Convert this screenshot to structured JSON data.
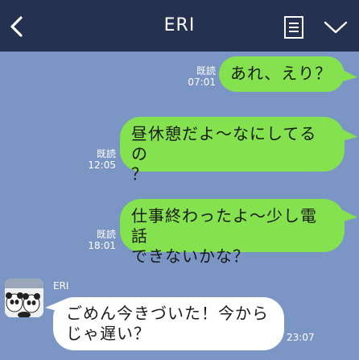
{
  "header": {
    "title": "ERI",
    "back_icon": "chevron-left-icon",
    "notes_icon": "notes-icon",
    "menu_icon": "chevron-down-icon",
    "background_color": "#243150"
  },
  "chat": {
    "background_color": "#7b96c4",
    "sent_bubble_color": "#84e24e",
    "received_bubble_color": "#ffffff",
    "messages": [
      {
        "direction": "sent",
        "lines": [
          "あれ、えり？"
        ],
        "read_label": "既読",
        "time": "07:01"
      },
      {
        "direction": "sent",
        "lines": [
          "昼休憩だよ〜なにしてるの",
          "？"
        ],
        "read_label": "既読",
        "time": "12:05"
      },
      {
        "direction": "sent",
        "lines": [
          "仕事終わったよ〜少し電話",
          "できないかな？"
        ],
        "read_label": "既読",
        "time": "18:01"
      },
      {
        "direction": "received",
        "sender": "ERI",
        "lines": [
          "ごめん今きづいた！今から",
          "じゃ遅い？"
        ],
        "time": "23:07"
      }
    ]
  }
}
